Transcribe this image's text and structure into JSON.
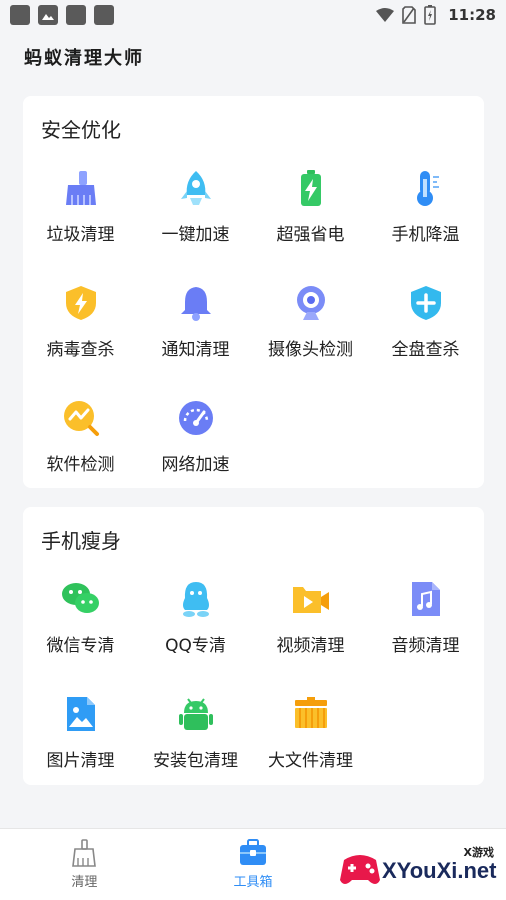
{
  "status_bar": {
    "time": "11:28"
  },
  "app": {
    "title": "蚂蚁清理大师"
  },
  "sections": [
    {
      "title": "安全优化",
      "items": [
        {
          "label": "垃圾清理",
          "icon": "broom-icon"
        },
        {
          "label": "一键加速",
          "icon": "rocket-icon"
        },
        {
          "label": "超强省电",
          "icon": "battery-icon"
        },
        {
          "label": "手机降温",
          "icon": "thermometer-icon"
        },
        {
          "label": "病毒查杀",
          "icon": "shield-lightning-icon"
        },
        {
          "label": "通知清理",
          "icon": "bell-icon"
        },
        {
          "label": "摄像头检测",
          "icon": "camera-icon"
        },
        {
          "label": "全盘查杀",
          "icon": "shield-plus-icon"
        },
        {
          "label": "软件检测",
          "icon": "chart-search-icon"
        },
        {
          "label": "网络加速",
          "icon": "speedometer-icon"
        }
      ]
    },
    {
      "title": "手机瘦身",
      "items": [
        {
          "label": "微信专清",
          "icon": "wechat-icon"
        },
        {
          "label": "QQ专清",
          "icon": "qq-penguin-icon"
        },
        {
          "label": "视频清理",
          "icon": "video-folder-icon"
        },
        {
          "label": "音频清理",
          "icon": "music-file-icon"
        },
        {
          "label": "图片清理",
          "icon": "image-file-icon"
        },
        {
          "label": "安装包清理",
          "icon": "android-icon"
        },
        {
          "label": "大文件清理",
          "icon": "big-file-icon"
        }
      ]
    }
  ],
  "bottom_nav": [
    {
      "label": "清理",
      "icon": "broom-icon",
      "active": false
    },
    {
      "label": "工具箱",
      "icon": "toolbox-icon",
      "active": true
    }
  ],
  "watermark": {
    "tag": "X游戏",
    "text": "XYouXi.net"
  },
  "colors": {
    "accent": "#2f8df5",
    "card_bg": "#ffffff",
    "page_bg": "#f4f5f7"
  }
}
